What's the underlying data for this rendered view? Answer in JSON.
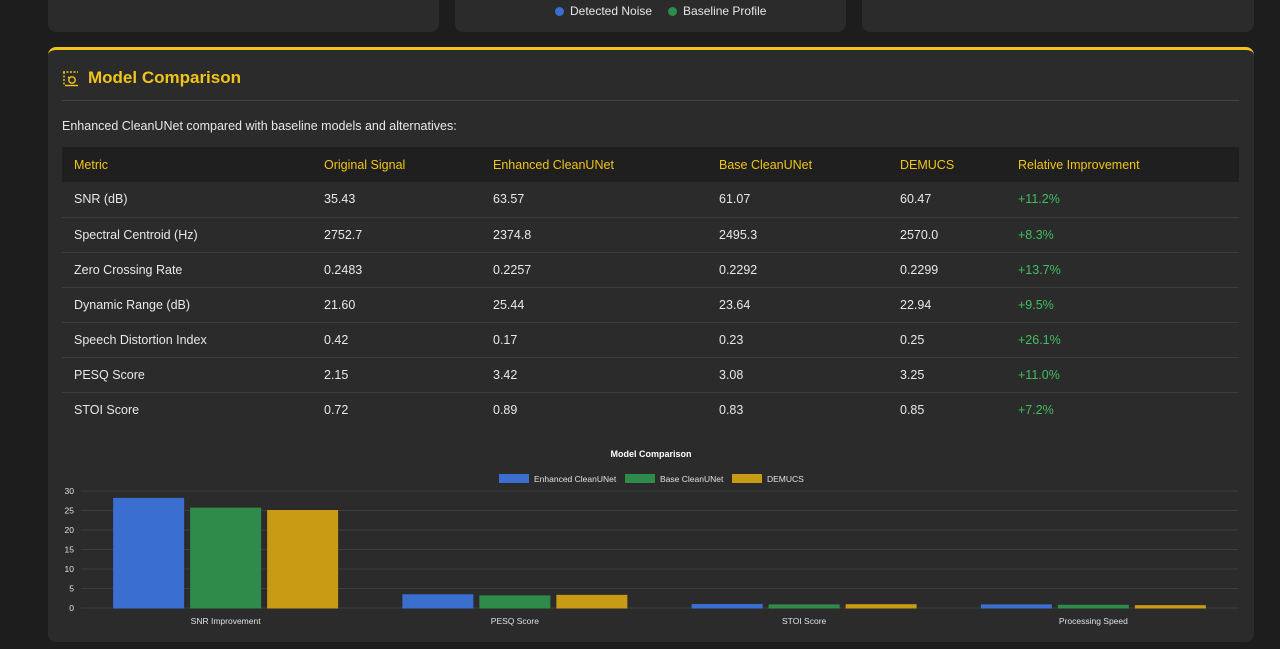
{
  "top_legend": {
    "items": [
      {
        "label": "Detected Noise",
        "color": "#3b6fcf"
      },
      {
        "label": "Baseline Profile",
        "color": "#2e8b4a"
      }
    ]
  },
  "panel": {
    "title": "Model Comparison",
    "intro": "Enhanced CleanUNet compared with baseline models and alternatives:",
    "accent": "#f0c419"
  },
  "table": {
    "headers": [
      "Metric",
      "Original Signal",
      "Enhanced CleanUNet",
      "Base CleanUNet",
      "DEMUCS",
      "Relative Improvement"
    ],
    "rows": [
      [
        "SNR (dB)",
        "35.43",
        "63.57",
        "61.07",
        "60.47",
        "+11.2%"
      ],
      [
        "Spectral Centroid (Hz)",
        "2752.7",
        "2374.8",
        "2495.3",
        "2570.0",
        "+8.3%"
      ],
      [
        "Zero Crossing Rate",
        "0.2483",
        "0.2257",
        "0.2292",
        "0.2299",
        "+13.7%"
      ],
      [
        "Dynamic Range (dB)",
        "21.60",
        "25.44",
        "23.64",
        "22.94",
        "+9.5%"
      ],
      [
        "Speech Distortion Index",
        "0.42",
        "0.17",
        "0.23",
        "0.25",
        "+26.1%"
      ],
      [
        "PESQ Score",
        "2.15",
        "3.42",
        "3.08",
        "3.25",
        "+11.0%"
      ],
      [
        "STOI Score",
        "0.72",
        "0.89",
        "0.83",
        "0.85",
        "+7.2%"
      ]
    ]
  },
  "chart_data": {
    "type": "bar",
    "title": "Model Comparison",
    "xlabel": "",
    "ylabel": "",
    "categories": [
      "SNR Improvement",
      "PESQ Score",
      "STOI Score",
      "Processing Speed"
    ],
    "series": [
      {
        "name": "Enhanced CleanUNet",
        "color": "#3b6fcf",
        "values": [
          28.1,
          3.4,
          0.9,
          0.8
        ]
      },
      {
        "name": "Base CleanUNet",
        "color": "#2e8b4a",
        "values": [
          25.6,
          3.1,
          0.8,
          0.7
        ]
      },
      {
        "name": "DEMUCS",
        "color": "#c99a14",
        "values": [
          25.0,
          3.25,
          0.85,
          0.6
        ]
      }
    ],
    "ylim": [
      0,
      30
    ],
    "yticks": [
      0,
      5,
      10,
      15,
      20,
      25,
      30
    ],
    "grid": true,
    "legend": "top"
  }
}
